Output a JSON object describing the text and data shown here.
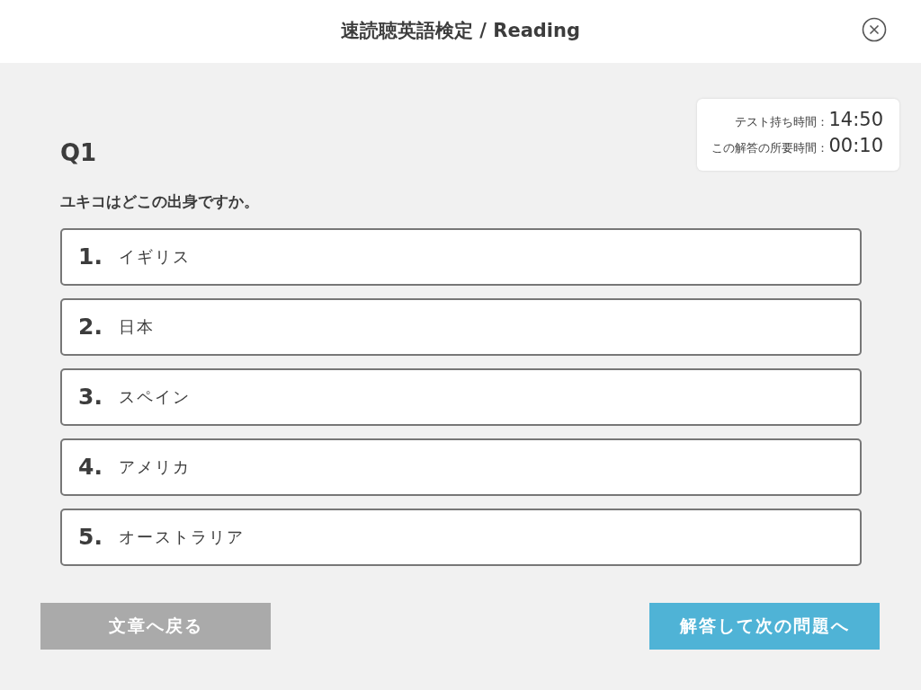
{
  "header": {
    "title": "速読聴英語検定 / Reading"
  },
  "timer": [
    {
      "label": "テスト持ち時間：",
      "value": "14:50"
    },
    {
      "label": "この解答の所要時間：",
      "value": "00:10"
    }
  ],
  "question": {
    "number": "Q1",
    "text": "ユキコはどこの出身ですか。"
  },
  "options": [
    {
      "number": "1.",
      "text": "イギリス"
    },
    {
      "number": "2.",
      "text": "日本"
    },
    {
      "number": "3.",
      "text": "スペイン"
    },
    {
      "number": "4.",
      "text": "アメリカ"
    },
    {
      "number": "5.",
      "text": "オーストラリア"
    }
  ],
  "buttons": [
    {
      "label": "文章へ戻る",
      "kind": "secondary"
    },
    {
      "label": "解答して次の問題へ",
      "kind": "primary"
    }
  ]
}
